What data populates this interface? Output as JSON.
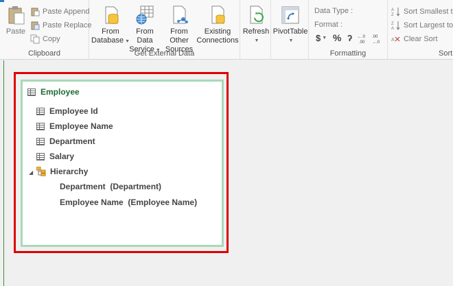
{
  "ribbon": {
    "clipboard": {
      "paste_label": "Paste",
      "paste_append_label": "Paste Append",
      "paste_replace_label": "Paste Replace",
      "copy_label": "Copy",
      "group_label": "Clipboard"
    },
    "external_data": {
      "from_database_line1": "From",
      "from_database_line2": "Database",
      "from_data_service_line1": "From Data",
      "from_data_service_line2": "Service",
      "from_other_sources_line1": "From Other",
      "from_other_sources_line2": "Sources",
      "existing_connections_line1": "Existing",
      "existing_connections_line2": "Connections",
      "group_label": "Get External Data"
    },
    "refresh": {
      "label": "Refresh"
    },
    "pivot": {
      "label": "PivotTable"
    },
    "formatting": {
      "data_type_label": "Data Type :",
      "format_label": "Format :",
      "currency_symbol": "$",
      "percent_symbol": "%",
      "comma_symbol": "ʔ",
      "inc_decimal": "+.0\n.00",
      "dec_decimal": ".00\n+.0",
      "group_label": "Formatting"
    },
    "sort": {
      "smallest_label": "Sort Smallest to",
      "largest_label": "Sort Largest to S",
      "clear_label": "Clear Sort",
      "group_label": "Sort"
    }
  },
  "table": {
    "name": "Employee",
    "fields": [
      "Employee Id",
      "Employee Name",
      "Department",
      "Salary"
    ],
    "hierarchy": {
      "name": "Hierarchy",
      "levels": [
        "Department  (Department)",
        "Employee Name  (Employee Name)"
      ]
    }
  },
  "colors": {
    "table_title": "#1e6b34",
    "card_border": "#a9d8b8",
    "highlight": "#e00000"
  }
}
